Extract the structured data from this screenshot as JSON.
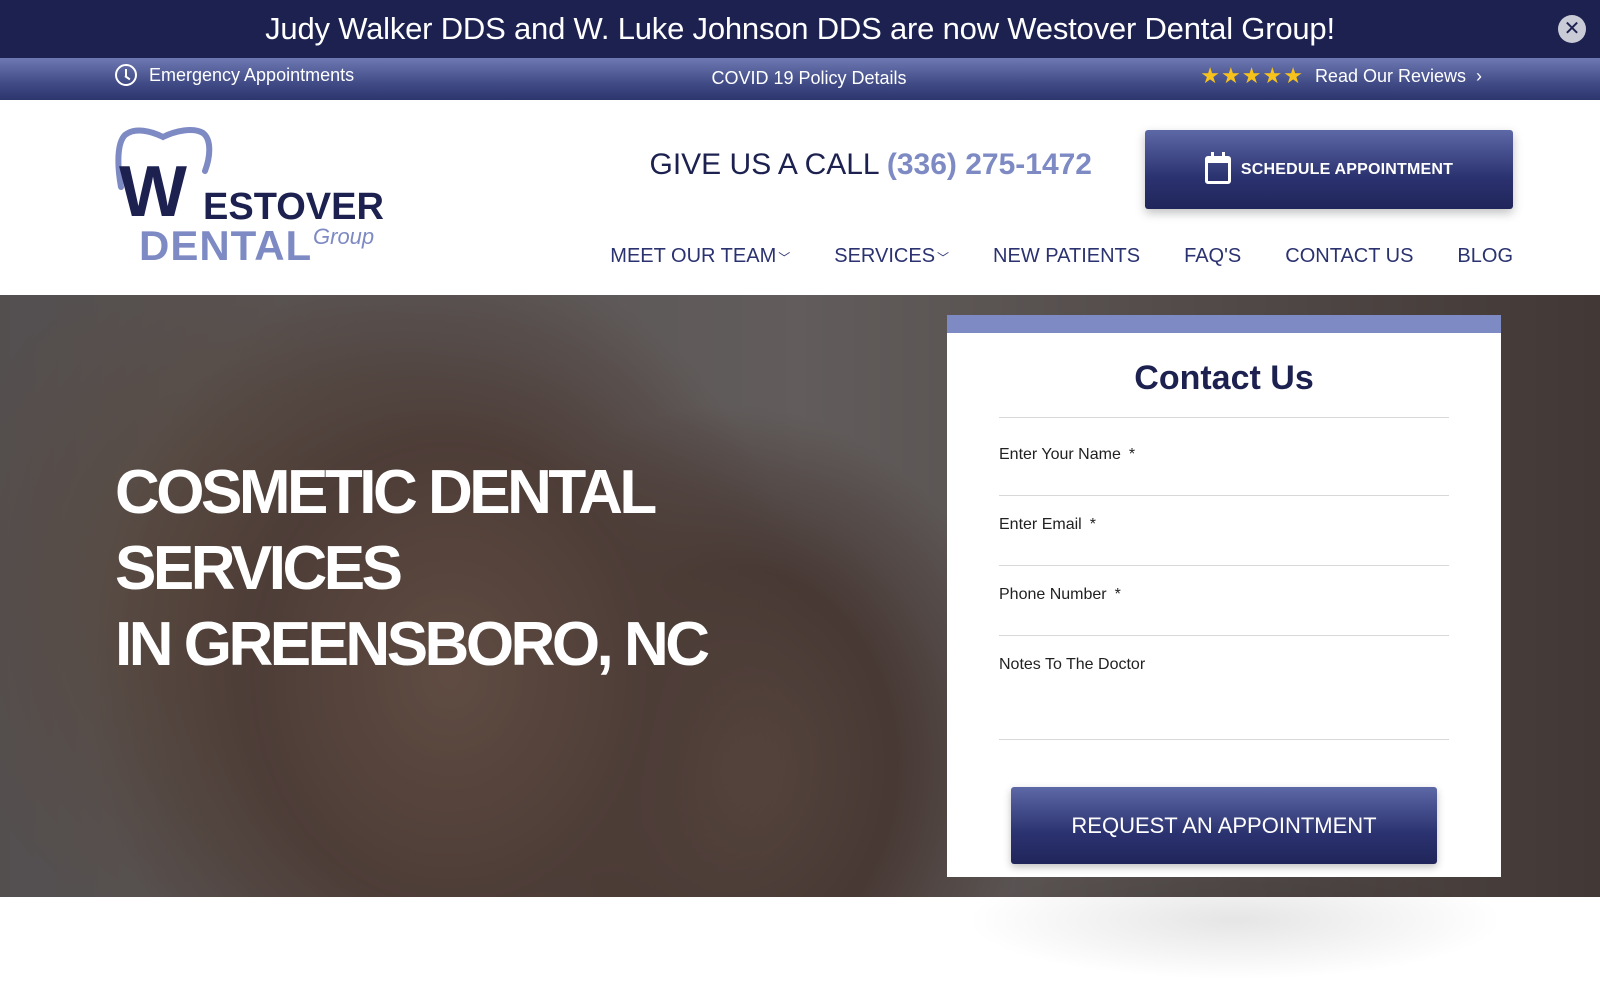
{
  "announcement": {
    "text": "Judy Walker DDS and W. Luke Johnson DDS are now Westover Dental Group!",
    "close_icon": "close-icon"
  },
  "utility_bar": {
    "emergency": "Emergency Appointments",
    "covid": "COVID 19 Policy Details",
    "reviews": "Read Our Reviews",
    "rating_stars": 5
  },
  "logo": {
    "w": "W",
    "estover": "ESTOVER",
    "dental": "DENTAL",
    "group": "Group"
  },
  "header": {
    "call_prefix": "GIVE US A CALL",
    "phone": "(336) 275-1472",
    "schedule_label": "SCHEDULE APPOINTMENT"
  },
  "nav": {
    "items": [
      {
        "label": "MEET OUR TEAM",
        "dropdown": true
      },
      {
        "label": "SERVICES",
        "dropdown": true
      },
      {
        "label": "NEW PATIENTS",
        "dropdown": false
      },
      {
        "label": "FAQ'S",
        "dropdown": false
      },
      {
        "label": "CONTACT US",
        "dropdown": false
      },
      {
        "label": "BLOG",
        "dropdown": false
      }
    ]
  },
  "hero": {
    "line1": "COSMETIC DENTAL SERVICES",
    "line2": "IN GREENSBORO, NC"
  },
  "contact_form": {
    "title": "Contact Us",
    "name_label": "Enter Your Name",
    "email_label": "Enter Email",
    "phone_label": "Phone Number",
    "notes_label": "Notes To The Doctor",
    "required_mark": "*",
    "submit_label": "REQUEST AN APPOINTMENT"
  },
  "colors": {
    "navy": "#1c2150",
    "accent": "#7e8ac3",
    "star": "#f8c21c"
  }
}
